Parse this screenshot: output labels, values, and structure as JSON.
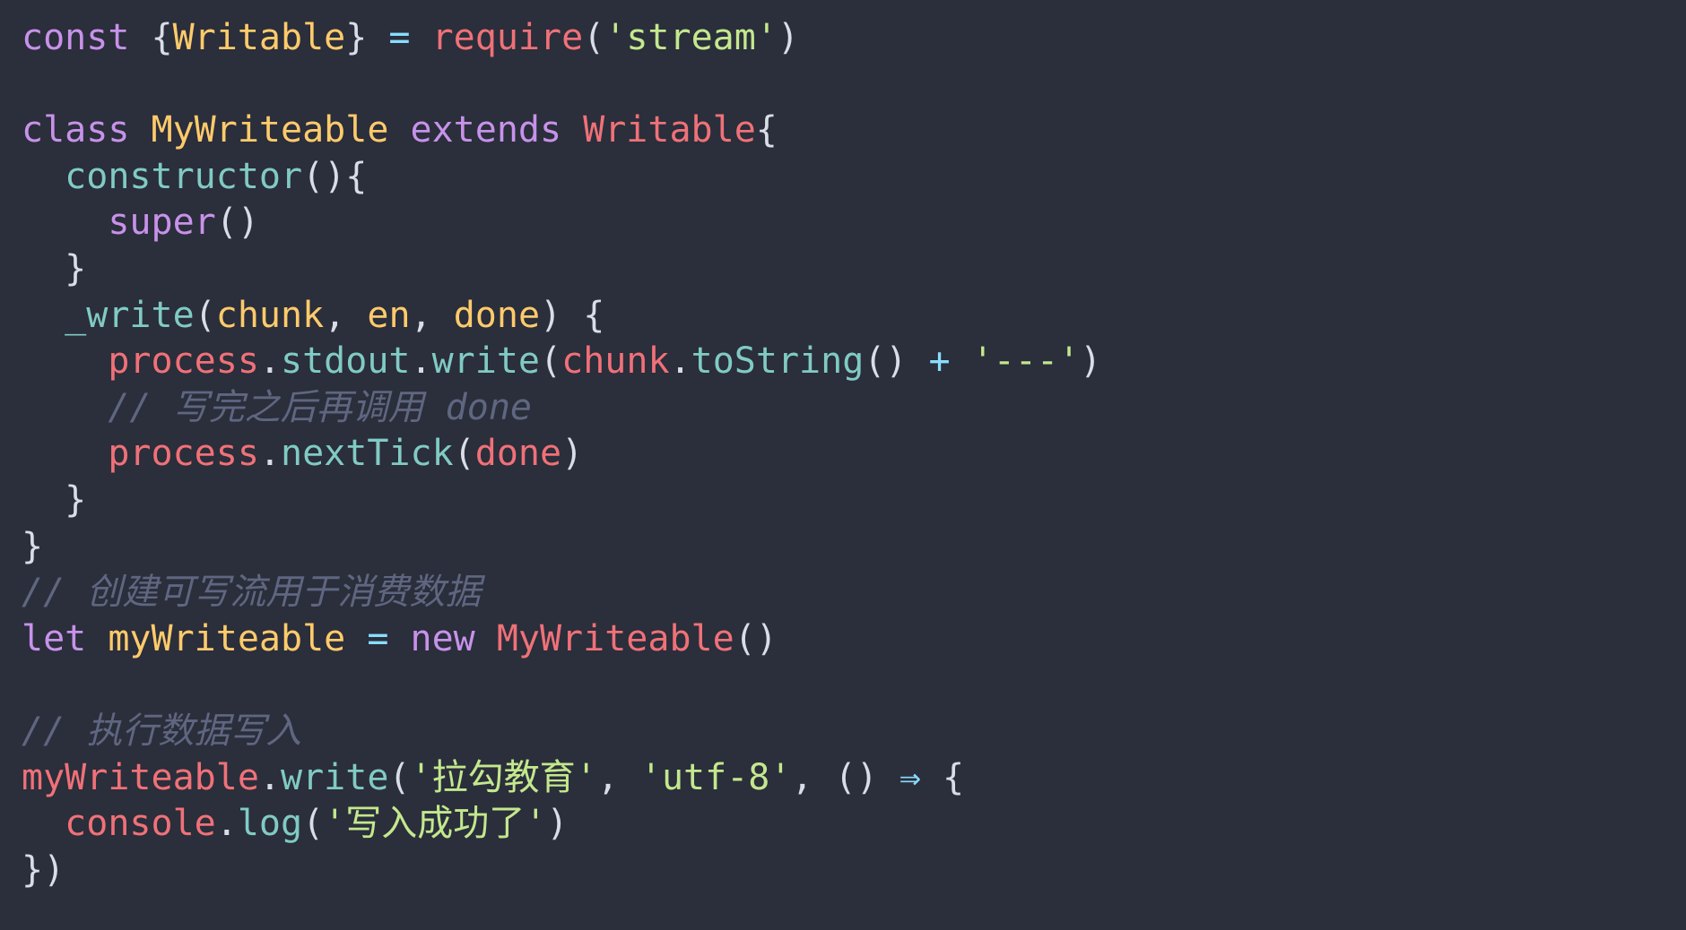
{
  "editor": {
    "lines": [
      [
        {
          "t": "const ",
          "c": "kw"
        },
        {
          "t": "{",
          "c": "pun"
        },
        {
          "t": "Writable",
          "c": "id"
        },
        {
          "t": "}",
          "c": "pun"
        },
        {
          "t": " = ",
          "c": "op"
        },
        {
          "t": "require",
          "c": "red"
        },
        {
          "t": "(",
          "c": "pun"
        },
        {
          "t": "'stream'",
          "c": "str"
        },
        {
          "t": ")",
          "c": "pun"
        }
      ],
      [],
      [
        {
          "t": "class ",
          "c": "kw"
        },
        {
          "t": "MyWriteable ",
          "c": "id"
        },
        {
          "t": "extends ",
          "c": "kw"
        },
        {
          "t": "Writable",
          "c": "cls"
        },
        {
          "t": "{",
          "c": "pun"
        }
      ],
      [
        {
          "t": "  ",
          "c": "plain"
        },
        {
          "t": "constructor",
          "c": "teal"
        },
        {
          "t": "(){",
          "c": "pun"
        }
      ],
      [
        {
          "t": "    ",
          "c": "plain"
        },
        {
          "t": "super",
          "c": "kw"
        },
        {
          "t": "()",
          "c": "pun"
        }
      ],
      [
        {
          "t": "  }",
          "c": "pun"
        }
      ],
      [
        {
          "t": "  ",
          "c": "plain"
        },
        {
          "t": "_write",
          "c": "teal"
        },
        {
          "t": "(",
          "c": "pun"
        },
        {
          "t": "chunk",
          "c": "id"
        },
        {
          "t": ", ",
          "c": "pun"
        },
        {
          "t": "en",
          "c": "id"
        },
        {
          "t": ", ",
          "c": "pun"
        },
        {
          "t": "done",
          "c": "id"
        },
        {
          "t": ") {",
          "c": "pun"
        }
      ],
      [
        {
          "t": "    ",
          "c": "plain"
        },
        {
          "t": "process",
          "c": "red"
        },
        {
          "t": ".",
          "c": "pun"
        },
        {
          "t": "stdout",
          "c": "teal"
        },
        {
          "t": ".",
          "c": "pun"
        },
        {
          "t": "write",
          "c": "teal"
        },
        {
          "t": "(",
          "c": "pun"
        },
        {
          "t": "chunk",
          "c": "red"
        },
        {
          "t": ".",
          "c": "pun"
        },
        {
          "t": "toString",
          "c": "teal"
        },
        {
          "t": "() ",
          "c": "pun"
        },
        {
          "t": "+ ",
          "c": "op"
        },
        {
          "t": "'---'",
          "c": "str"
        },
        {
          "t": ")",
          "c": "pun"
        }
      ],
      [
        {
          "t": "    // 写完之后再调用 done",
          "c": "cm"
        }
      ],
      [
        {
          "t": "    ",
          "c": "plain"
        },
        {
          "t": "process",
          "c": "red"
        },
        {
          "t": ".",
          "c": "pun"
        },
        {
          "t": "nextTick",
          "c": "teal"
        },
        {
          "t": "(",
          "c": "pun"
        },
        {
          "t": "done",
          "c": "red"
        },
        {
          "t": ")",
          "c": "pun"
        }
      ],
      [
        {
          "t": "  }",
          "c": "pun"
        }
      ],
      [
        {
          "t": "}",
          "c": "pun"
        }
      ],
      [
        {
          "t": "// 创建可写流用于消费数据",
          "c": "cm"
        }
      ],
      [
        {
          "t": "let ",
          "c": "kw"
        },
        {
          "t": "myWriteable ",
          "c": "id"
        },
        {
          "t": "= ",
          "c": "op"
        },
        {
          "t": "new ",
          "c": "kw"
        },
        {
          "t": "MyWriteable",
          "c": "cls"
        },
        {
          "t": "()",
          "c": "pun"
        }
      ],
      [],
      [
        {
          "t": "// 执行数据写入",
          "c": "cm"
        }
      ],
      [
        {
          "t": "myWriteable",
          "c": "red"
        },
        {
          "t": ".",
          "c": "pun"
        },
        {
          "t": "write",
          "c": "teal"
        },
        {
          "t": "(",
          "c": "pun"
        },
        {
          "t": "'拉勾教育'",
          "c": "str"
        },
        {
          "t": ", ",
          "c": "pun"
        },
        {
          "t": "'utf-8'",
          "c": "str"
        },
        {
          "t": ", ",
          "c": "pun"
        },
        {
          "t": "() ",
          "c": "pun"
        },
        {
          "t": "⇒ ",
          "c": "op"
        },
        {
          "t": "{",
          "c": "pun"
        }
      ],
      [
        {
          "t": "  ",
          "c": "plain"
        },
        {
          "t": "console",
          "c": "red"
        },
        {
          "t": ".",
          "c": "pun"
        },
        {
          "t": "log",
          "c": "teal"
        },
        {
          "t": "(",
          "c": "pun"
        },
        {
          "t": "'写入成功了'",
          "c": "str"
        },
        {
          "t": ")",
          "c": "pun"
        }
      ],
      [
        {
          "t": "})",
          "c": "pun"
        }
      ]
    ]
  }
}
